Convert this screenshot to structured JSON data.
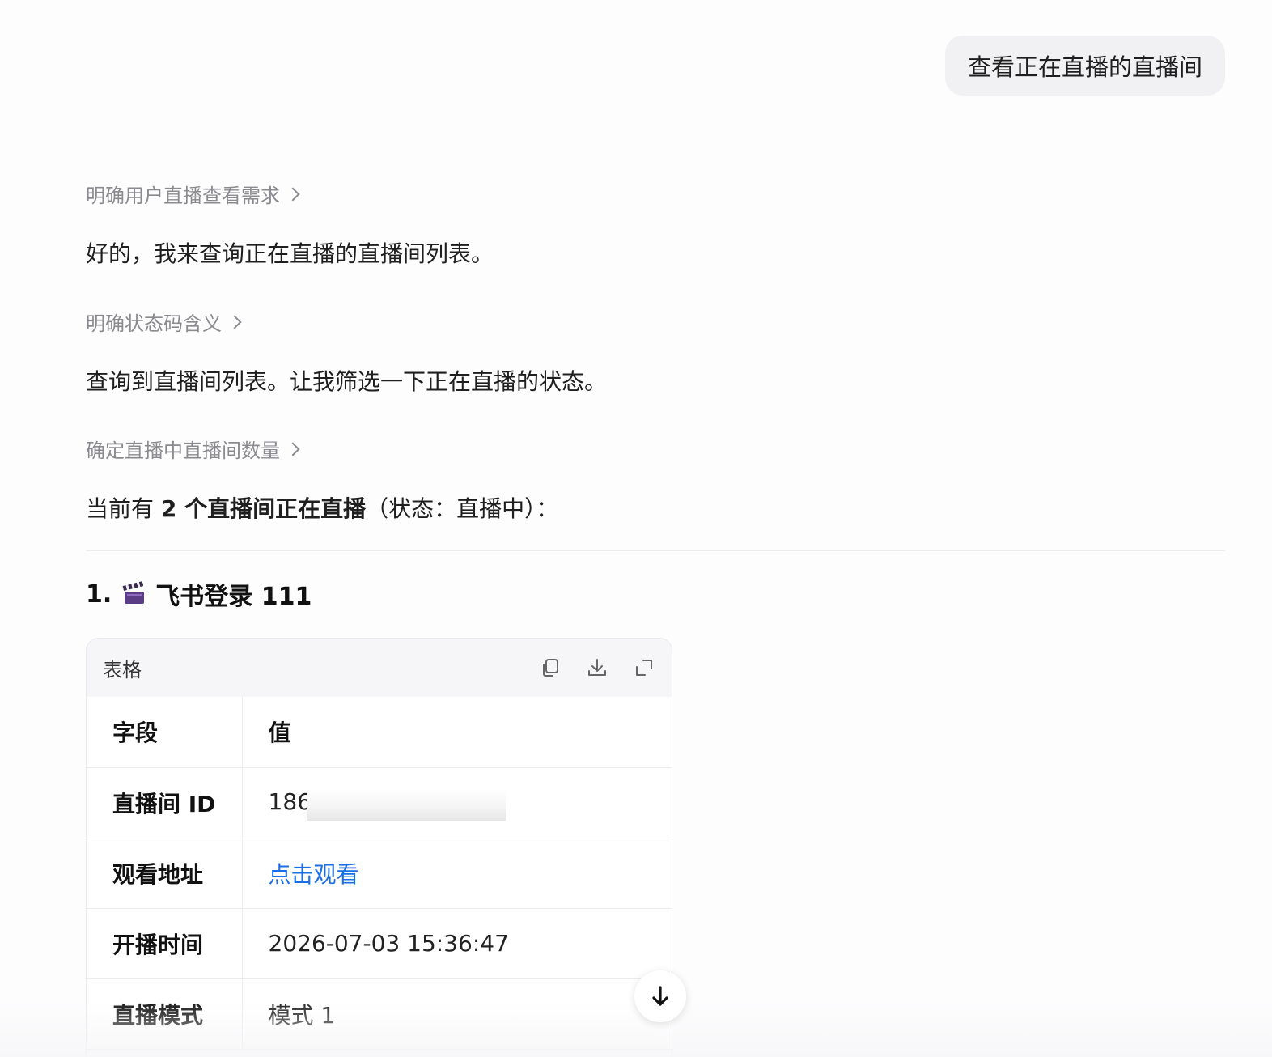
{
  "user_message": "查看正在直播的直播间",
  "reply": {
    "steps": [
      {
        "thinking": "明确用户直播查看需求",
        "text": "好的，我来查询正在直播的直播间列表。"
      },
      {
        "thinking": "明确状态码含义",
        "text": "查询到直播间列表。让我筛选一下正在直播的状态。"
      },
      {
        "thinking": "确定直播中直播间数量"
      }
    ],
    "summary": {
      "prefix": "当前有 ",
      "bold": "2 个直播间正在直播",
      "suffix": "（状态：直播中）："
    },
    "section_heading": {
      "number": "1.",
      "icon": "clapper-board-icon",
      "title": "飞书登录 111"
    }
  },
  "table_card": {
    "title": "表格",
    "tools": [
      "copy-icon",
      "download-icon",
      "expand-icon"
    ],
    "columns": [
      "字段",
      "值"
    ],
    "rows": [
      {
        "field": "直播间 ID",
        "value": "186"
      },
      {
        "field": "观看地址",
        "value": "点击观看"
      },
      {
        "field": "开播时间",
        "value": "2026-07-03 15:36:47"
      },
      {
        "field": "直播模式",
        "value": "模式 1"
      }
    ]
  },
  "scroll_button": {
    "icon": "arrow-down-icon"
  },
  "colors": {
    "link": "#1a6ee6",
    "muted": "#8a8a8f",
    "bubble": "#f1f1f3"
  }
}
